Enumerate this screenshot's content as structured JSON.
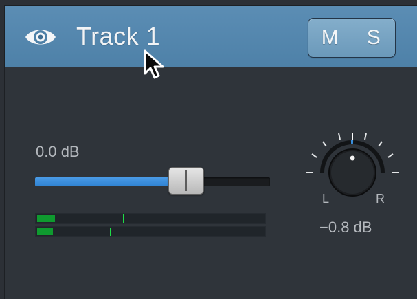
{
  "track": {
    "name": "Track 1",
    "visibility_icon": "eye-icon",
    "mute_label": "M",
    "solo_label": "S"
  },
  "volume": {
    "label": "0.0 dB",
    "fader_level": 0.64
  },
  "meters": [
    {
      "level": 0.08,
      "peak": 0.38
    },
    {
      "level": 0.07,
      "peak": 0.32
    }
  ],
  "pan": {
    "left_label": "L",
    "right_label": "R",
    "value_label": "−0.8 dB"
  },
  "colors": {
    "header": "#5588b0",
    "fader_fill": "#3a8fdc",
    "meter": "#0f9a2f",
    "background": "#2f343a"
  },
  "cursor_icon": "mouse-pointer-icon"
}
